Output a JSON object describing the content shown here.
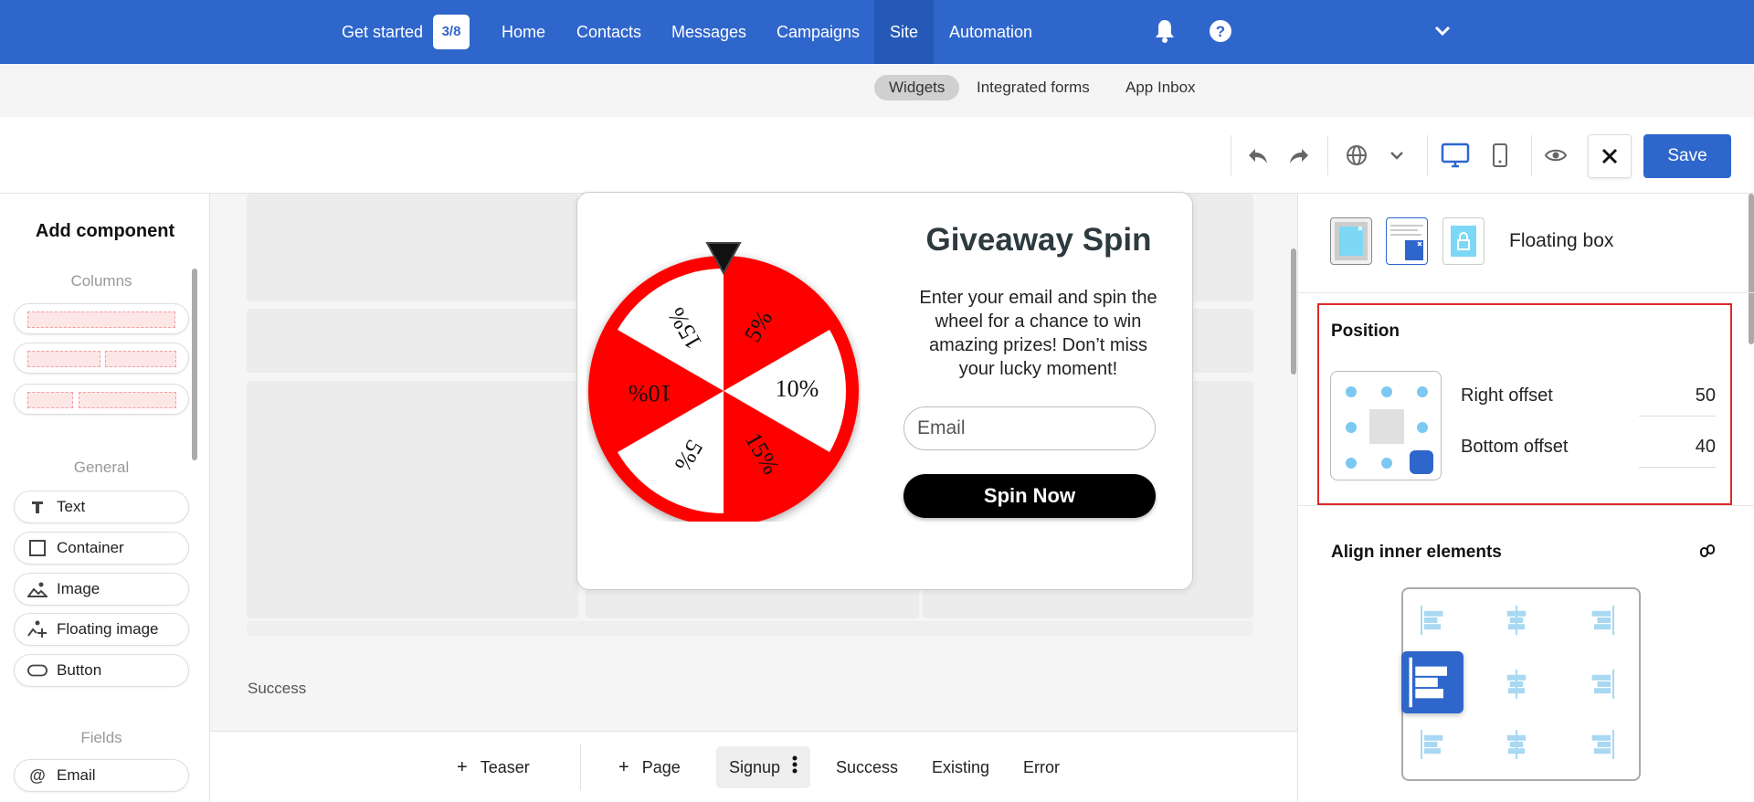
{
  "topnav": {
    "get_started": "Get started",
    "progress": "3/8",
    "items": [
      "Home",
      "Contacts",
      "Messages",
      "Campaigns",
      "Site",
      "Automation"
    ],
    "active_item": "Site",
    "icons": [
      "bell-icon",
      "help-icon",
      "chevron-down-icon"
    ]
  },
  "subnav": {
    "items": [
      "Widgets",
      "Integrated forms",
      "App Inbox"
    ],
    "active_item": "Widgets"
  },
  "toolbar": {
    "icons": [
      "undo-icon",
      "redo-icon",
      "globe-icon",
      "chevron-down-icon",
      "desktop-icon",
      "mobile-icon",
      "eye-icon",
      "close-icon"
    ],
    "save_label": "Save"
  },
  "left_panel": {
    "title": "Add component",
    "groups": {
      "columns": "Columns",
      "general": "General",
      "fields": "Fields"
    },
    "components": [
      "Text",
      "Container",
      "Image",
      "Floating image",
      "Button"
    ],
    "fields": [
      "Email"
    ]
  },
  "popup": {
    "title": "Giveaway Spin",
    "text": "Enter your email and spin the wheel for a chance to win amazing prizes! Don’t miss your lucky moment!",
    "email_placeholder": "Email",
    "button_label": "Spin Now",
    "wheel_segments": [
      "5%",
      "10%",
      "15%",
      "5%",
      "10%",
      "15%"
    ],
    "wheel_colors": [
      "#ff0000",
      "#ffffff"
    ]
  },
  "canvas": {
    "success_label": "Success"
  },
  "bottombar": {
    "add_teaser": "Teaser",
    "add_page": "Page",
    "tabs": [
      "Signup",
      "Success",
      "Existing",
      "Error"
    ],
    "active_tab": "Signup"
  },
  "right_panel": {
    "layout_title": "Floating box",
    "position": {
      "title": "Position",
      "right_offset_label": "Right offset",
      "right_offset_value": "50",
      "bottom_offset_label": "Bottom offset",
      "bottom_offset_value": "40",
      "selected_anchor": "bottom-right"
    },
    "align": {
      "title": "Align inner elements",
      "selected": "middle-left"
    }
  },
  "colors": {
    "brand": "#2f66cc",
    "highlight": "#e02828"
  }
}
